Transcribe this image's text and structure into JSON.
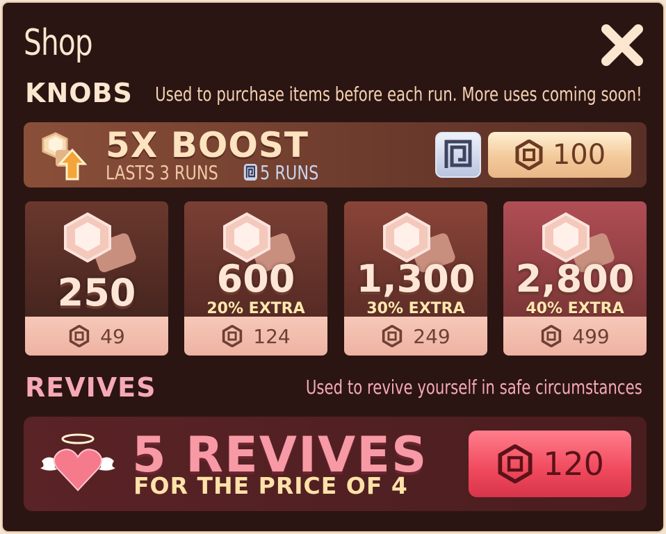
{
  "window": {
    "title": "Shop"
  },
  "knobs": {
    "title": "KNOBS",
    "description": "Used to purchase items before each run. More uses coming soon!",
    "boost": {
      "title": "5X BOOST",
      "subtitle": "LASTS 3 RUNS",
      "pass_runs": "5 RUNS",
      "price": "100"
    },
    "packs": [
      {
        "amount": "250",
        "extra": "",
        "price": "49"
      },
      {
        "amount": "600",
        "extra": "20% EXTRA",
        "price": "124"
      },
      {
        "amount": "1,300",
        "extra": "30% EXTRA",
        "price": "249"
      },
      {
        "amount": "2,800",
        "extra": "40% EXTRA",
        "price": "499"
      }
    ]
  },
  "revives": {
    "title": "REVIVES",
    "description": "Used to revive yourself in safe circumstances",
    "offer": {
      "title": "5 REVIVES",
      "subtitle": "FOR THE PRICE OF 4",
      "price": "120"
    }
  },
  "icons": {
    "close": "close-icon",
    "currency": "robux-icon",
    "pass": "game-pass-icon",
    "boost": "knob-boost-icon",
    "knob": "knob-icon",
    "revive": "winged-heart-icon"
  },
  "colors": {
    "background": "#2a1513",
    "accent_cream": "#fde6cf",
    "revive_pink": "#f79aa6",
    "revive_button": "#f0485c",
    "boost_button": "#f3c99a"
  }
}
